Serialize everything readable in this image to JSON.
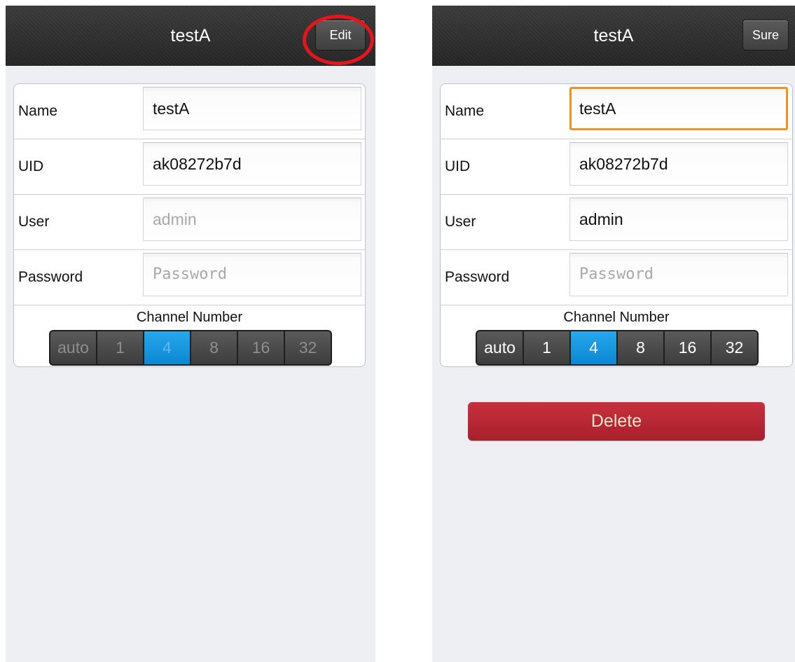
{
  "left": {
    "title": "testA",
    "edit_label": "Edit",
    "fields": [
      {
        "label": "Name",
        "value": "testA"
      },
      {
        "label": "UID",
        "value": "ak08272b7d"
      },
      {
        "label": "User",
        "value": "admin"
      },
      {
        "label": "Password",
        "placeholder": "Password"
      }
    ],
    "channel_title": "Channel Number",
    "channel_options": [
      "auto",
      "1",
      "4",
      "8",
      "16",
      "32"
    ],
    "channel_selected": "4"
  },
  "right": {
    "title": "testA",
    "sure_label": "Sure",
    "fields": [
      {
        "label": "Name",
        "value": "testA"
      },
      {
        "label": "UID",
        "value": "ak08272b7d"
      },
      {
        "label": "User",
        "value": "admin"
      },
      {
        "label": "Password",
        "placeholder": "Password"
      }
    ],
    "channel_title": "Channel Number",
    "channel_options": [
      "auto",
      "1",
      "4",
      "8",
      "16",
      "32"
    ],
    "channel_selected": "4",
    "delete_label": "Delete"
  },
  "colors": {
    "topbar": "#2c2c2c",
    "background": "#eeeff3",
    "selected_segment": "#1a9be3",
    "focus_border": "#ef9320",
    "delete_button": "#b8262f",
    "highlight_circle": "#e8141c"
  }
}
